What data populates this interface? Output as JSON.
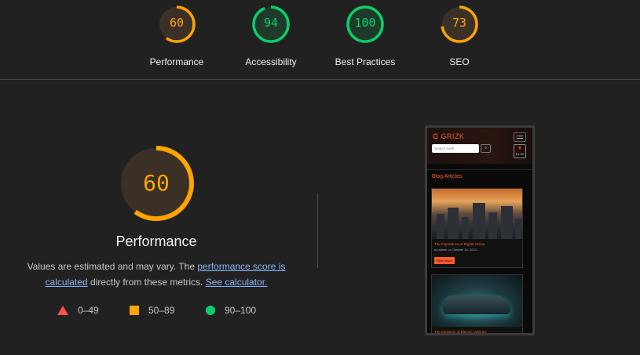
{
  "colors": {
    "orange": "#ffa400",
    "green": "#0cce6b",
    "red": "#ff4e42",
    "ring_bg": "#3b3026",
    "green_bg": "#1f3a2a"
  },
  "categories": [
    {
      "label": "Performance",
      "score": "60",
      "fraction": 0.6,
      "status": "average"
    },
    {
      "label": "Accessibility",
      "score": "94",
      "fraction": 0.94,
      "status": "pass"
    },
    {
      "label": "Best Practices",
      "score": "100",
      "fraction": 1.0,
      "status": "pass"
    },
    {
      "label": "SEO",
      "score": "73",
      "fraction": 0.73,
      "status": "average"
    }
  ],
  "main": {
    "score": "60",
    "fraction": 0.6,
    "title": "Performance",
    "desc_pre": "Values are estimated and may vary. The ",
    "link_score": "performance score is calculated",
    "desc_mid": " directly from these metrics. ",
    "link_calc": "See calculator."
  },
  "legend": [
    {
      "range": "0–49",
      "icon": "triangle-icon"
    },
    {
      "range": "50–89",
      "icon": "square-icon"
    },
    {
      "range": "90–100",
      "icon": "circle-icon"
    }
  ],
  "phone": {
    "logo": "GRIZK",
    "search_placeholder": "Search book",
    "cart_price": "£1.00",
    "section_title": "Blog Articles",
    "card1_title": "The Importance of Digital Online",
    "card1_meta": "by admin on October 15, 2024",
    "card1_button": "Read More",
    "card2_title": "The Evolution of Electric Vehicles"
  }
}
